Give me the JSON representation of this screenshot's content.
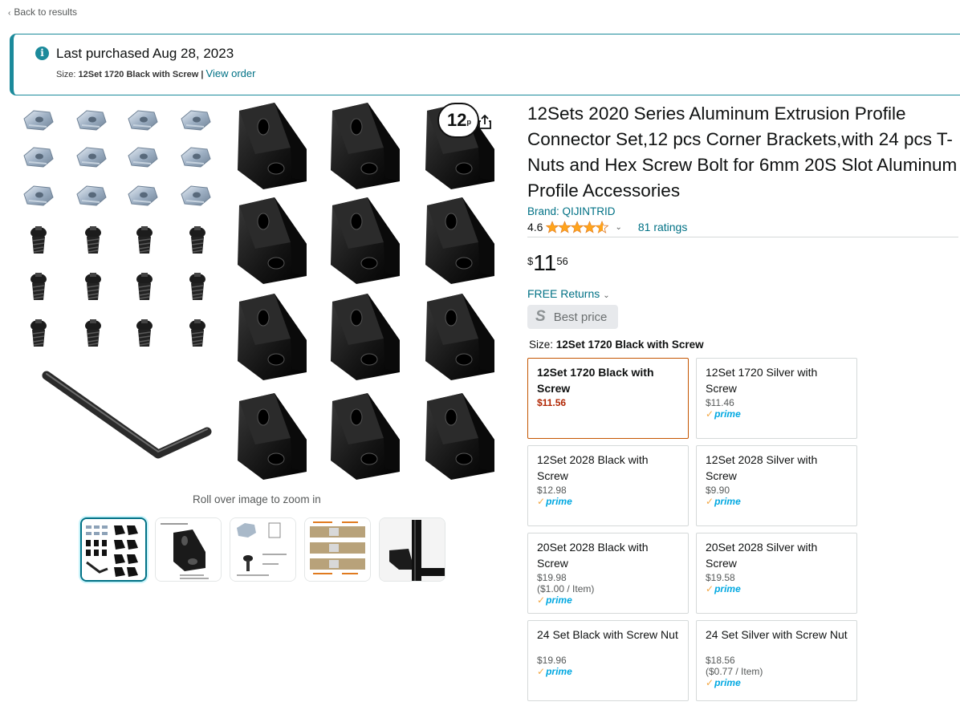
{
  "nav": {
    "back_label": "Back to results"
  },
  "purchase_banner": {
    "title": "Last purchased Aug 28, 2023",
    "size_prefix": "Size:",
    "size_value": "12Set 1720 Black with Screw",
    "separator": "|",
    "link_label": "View order"
  },
  "gallery": {
    "badge_count": "12",
    "badge_unit": "p",
    "zoom_hint": "Roll over image to zoom in",
    "thumbnails": [
      "kit-overview",
      "bracket-dimensions",
      "t-nut-and-screw",
      "installation-steps",
      "installed-on-profile"
    ]
  },
  "product": {
    "title": "12Sets 2020 Series Aluminum Extrusion Profile Connector Set,12 pcs Corner Brackets,with 24 pcs T-Nuts and Hex Screw Bolt for 6mm 20S Slot Aluminum Profile Accessories",
    "brand": "Brand: QIJINTRID",
    "rating": "4.6",
    "stars": 4.6,
    "ratings_count": "81 ratings",
    "price_symbol": "$",
    "price_whole": "11",
    "price_fraction": "56",
    "returns": "FREE Returns",
    "best_price": "Best price",
    "size_label": "Size:",
    "size_selected": "12Set 1720 Black with Screw"
  },
  "size_options": [
    {
      "name": "12Set 1720 Black with Screw",
      "price": "$11.56",
      "unit": "",
      "prime": false,
      "selected": true
    },
    {
      "name": "12Set 1720 Silver with Screw",
      "price": "$11.46",
      "unit": "",
      "prime": true,
      "selected": false
    },
    {
      "name": "12Set 2028 Black with Screw",
      "price": "$12.98",
      "unit": "",
      "prime": true,
      "selected": false
    },
    {
      "name": "12Set 2028 Silver with Screw",
      "price": "$9.90",
      "unit": "",
      "prime": true,
      "selected": false
    },
    {
      "name": "20Set 2028 Black with Screw",
      "price": "$19.98",
      "unit": "($1.00 / Item)",
      "prime": true,
      "selected": false
    },
    {
      "name": "20Set 2028 Silver with Screw",
      "price": "$19.58",
      "unit": "",
      "prime": true,
      "selected": false
    },
    {
      "name": "24 Set Black with Screw Nut",
      "price": "$19.96",
      "unit": "",
      "prime": true,
      "selected": false
    },
    {
      "name": "24 Set Silver with Screw Nut",
      "price": "$18.56",
      "unit": "($0.77 / Item)",
      "prime": true,
      "selected": false
    }
  ],
  "prime_label": "prime",
  "colors": {
    "link": "#007185",
    "accent": "#1b8a9b",
    "star": "#ffa41c",
    "price_red": "#b12704",
    "selected_border": "#c45500",
    "prime_blue": "#00a8e1"
  },
  "icons": {
    "info": "info-icon",
    "share": "share-icon",
    "chevron": "chevron-down-icon",
    "back": "chevron-left-icon",
    "best_price": "s-logo-icon"
  }
}
